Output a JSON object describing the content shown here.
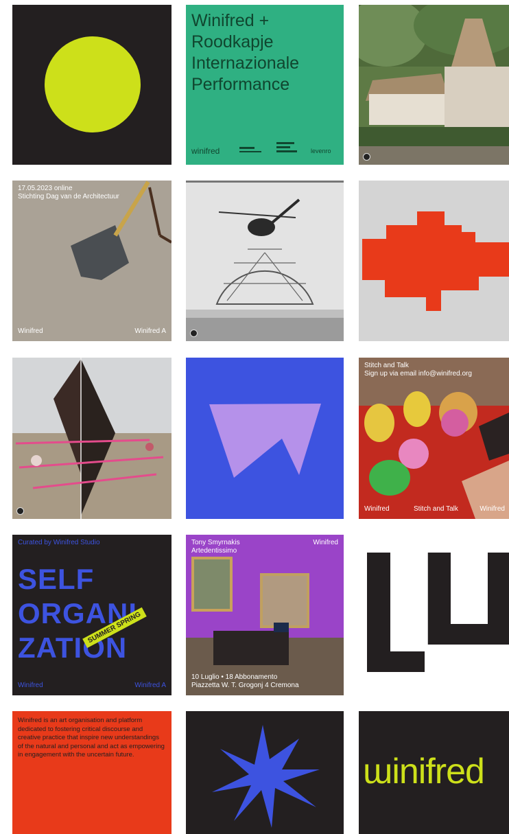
{
  "tiles": {
    "yellow_circle": {
      "bg": "#231f20",
      "circle_color": "#cde01a"
    },
    "green_poster": {
      "bg": "#2fb082",
      "title_lines": [
        "Winifred +",
        "Roodkapje",
        "Internazionale",
        "Performance"
      ],
      "footer_logo_1": "winifred",
      "footer_logo_4": "levenro"
    },
    "shovel": {
      "line1": "17.05.2023 online",
      "line2": "Stichting Dag van de Architectuur",
      "footer_left": "Winifred",
      "footer_right": "Winifred A"
    },
    "concert": {
      "header_left": "Tony Smyrnakis",
      "header_right": "Winifred",
      "header_line2": "Artedentissimo",
      "footer_line1": "10 Luglio • 18 Abbonamento",
      "footer_line2": "Piazzetta W. T. Grogonj 4 Cremona"
    },
    "self_org": {
      "top_text": "Curated by Winifred Studio",
      "words": [
        "SELF",
        "ORGANI",
        "ZATION"
      ],
      "sticker": "SUMMER SPRING",
      "footer_left": "Winifred",
      "footer_right": "Winifred A"
    },
    "stitch": {
      "line1": "Stitch and Talk",
      "line2": "Sign up via email info@winifred.org",
      "footer_left": "Winifred",
      "footer_mid": "Stitch and Talk",
      "footer_right": "Winifred"
    },
    "manifesto": {
      "text": "Winifred is an art organisation and platform dedicated to fostering critical discourse and creative practice that inspire new understandings of the natural and personal and act as empowering in engagement with the uncertain future."
    },
    "wordmark": {
      "text": "ɯinifred",
      "color": "#cde01a"
    }
  }
}
